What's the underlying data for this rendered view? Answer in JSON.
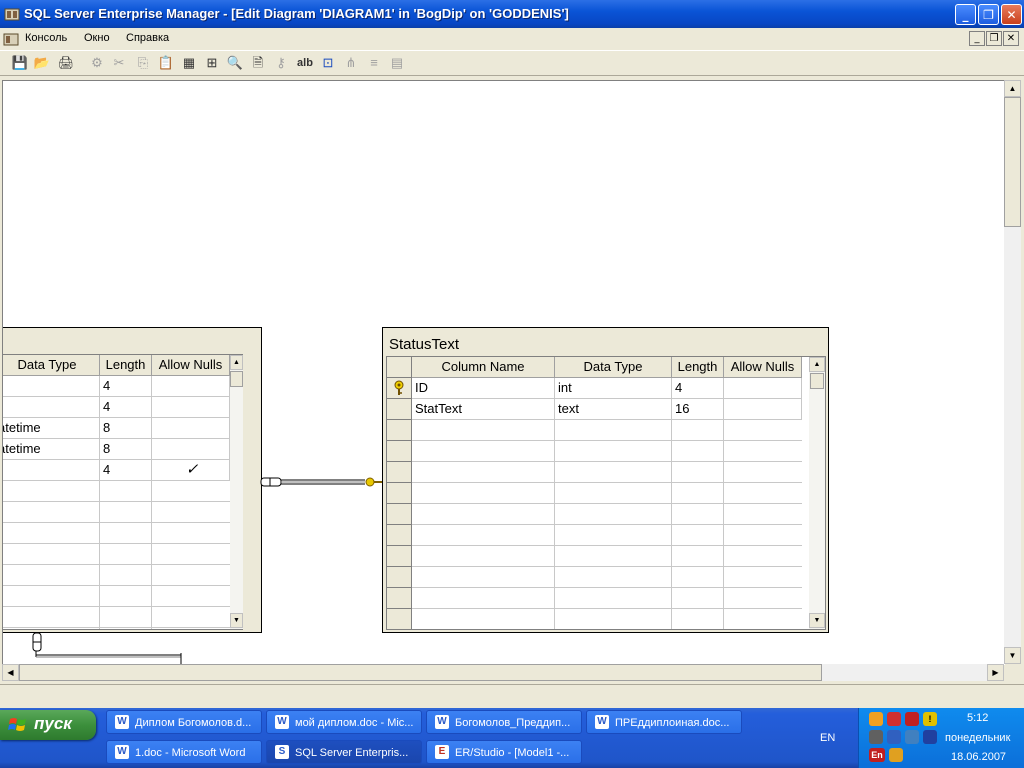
{
  "window": {
    "title": "SQL Server Enterprise Manager - [Edit Diagram 'DIAGRAM1' in 'BogDip' on 'GODDENIS']",
    "min_glyph": "_",
    "restore_glyph": "❐",
    "close_glyph": "✕"
  },
  "menu": {
    "items": [
      "Консоль",
      "Окно",
      "Справка"
    ],
    "mdi_min": "_",
    "mdi_restore": "❐",
    "mdi_close": "✕"
  },
  "toolbar": {
    "glyphs": [
      "💾",
      "📂",
      "🖨",
      "⚙",
      "✂",
      "⎘",
      "📋",
      "▦",
      "⊞",
      "🔍",
      "🗎",
      "⚷",
      "alb",
      "⊡",
      "⋔",
      "≡",
      "▤"
    ]
  },
  "left_table": {
    "headers": [
      "Data Type",
      "Length",
      "Allow Nulls"
    ],
    "rows": [
      {
        "type": "t",
        "length": "4",
        "nulls": ""
      },
      {
        "type": "t",
        "length": "4",
        "nulls": ""
      },
      {
        "type": "atetime",
        "length": "8",
        "nulls": ""
      },
      {
        "type": "atetime",
        "length": "8",
        "nulls": ""
      },
      {
        "type": "t",
        "length": "4",
        "nulls": "✓"
      }
    ]
  },
  "right_table": {
    "title": "StatusText",
    "headers": [
      "Column Name",
      "Data Type",
      "Length",
      "Allow Nulls"
    ],
    "rows": [
      {
        "name": "ID",
        "type": "int",
        "length": "4",
        "nulls": "",
        "key": true
      },
      {
        "name": "StatText",
        "type": "text",
        "length": "16",
        "nulls": "",
        "key": false
      }
    ]
  },
  "taskbar": {
    "start_label": "пуск",
    "tasks_row1": [
      {
        "label": "Диплом Богомолов.d...",
        "icon": "W"
      },
      {
        "label": "мой диплом.doc - Mic...",
        "icon": "W"
      },
      {
        "label": "Богомолов_Преддип...",
        "icon": "W"
      },
      {
        "label": "ПРЕддиплоиная.doc...",
        "icon": "W"
      }
    ],
    "tasks_row2": [
      {
        "label": "1.doc - Microsoft Word",
        "icon": "W"
      },
      {
        "label": "SQL Server Enterpris...",
        "icon": "S"
      },
      {
        "label": "ER/Studio - [Model1 -...",
        "icon": "E"
      }
    ],
    "language": "EN",
    "tray_lang": "En",
    "time": "5:12",
    "day": "понедельник",
    "date": "18.06.2007"
  }
}
